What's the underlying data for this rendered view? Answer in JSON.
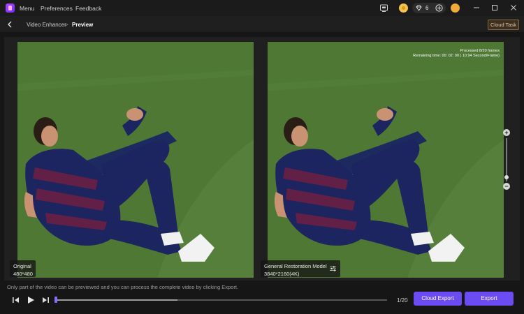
{
  "titlebar": {
    "menu_label": "Menu",
    "preferences_label": "Preferences",
    "feedback_label": "Feedback",
    "gem_count": "6"
  },
  "navbar": {
    "crumb_parent": "Video Enhancer",
    "crumb_separator": ">",
    "crumb_current": "Preview",
    "cloud_task_label": "Cloud Task"
  },
  "preview": {
    "left_label_title": "Original",
    "left_label_resolution": "480*480",
    "right_label_title": "General Restoration Model",
    "right_label_resolution": "3840*2160(4K)",
    "overlay_line1": "Processed 8/20 frames",
    "overlay_line2": "Remaining time: 00: 02: 00 ( 10.94 Second/Frame)"
  },
  "zoom": {
    "plus": "+",
    "minus": "−",
    "level": 0.1
  },
  "bottom": {
    "hint": "Only part of the video can be previewed and you can process the complete video by clicking Export.",
    "frame_counter": "1/20",
    "cloud_export_label": "Cloud Export",
    "export_label": "Export",
    "timeline_processed": 0.37,
    "timeline_position": 0.0
  },
  "colors": {
    "accent": "#6a4cf2",
    "cloud_task_border": "#8a6a3a",
    "field_green": "#4f7a34"
  },
  "icons": [
    "app-logo-icon",
    "monitor-icon",
    "coin-icon",
    "gem-icon",
    "plus-circle-icon",
    "avatar-icon",
    "minimize-icon",
    "maximize-icon",
    "close-icon",
    "back-chevron-icon",
    "sliders-icon",
    "prev-frame-icon",
    "play-icon",
    "next-frame-icon"
  ]
}
